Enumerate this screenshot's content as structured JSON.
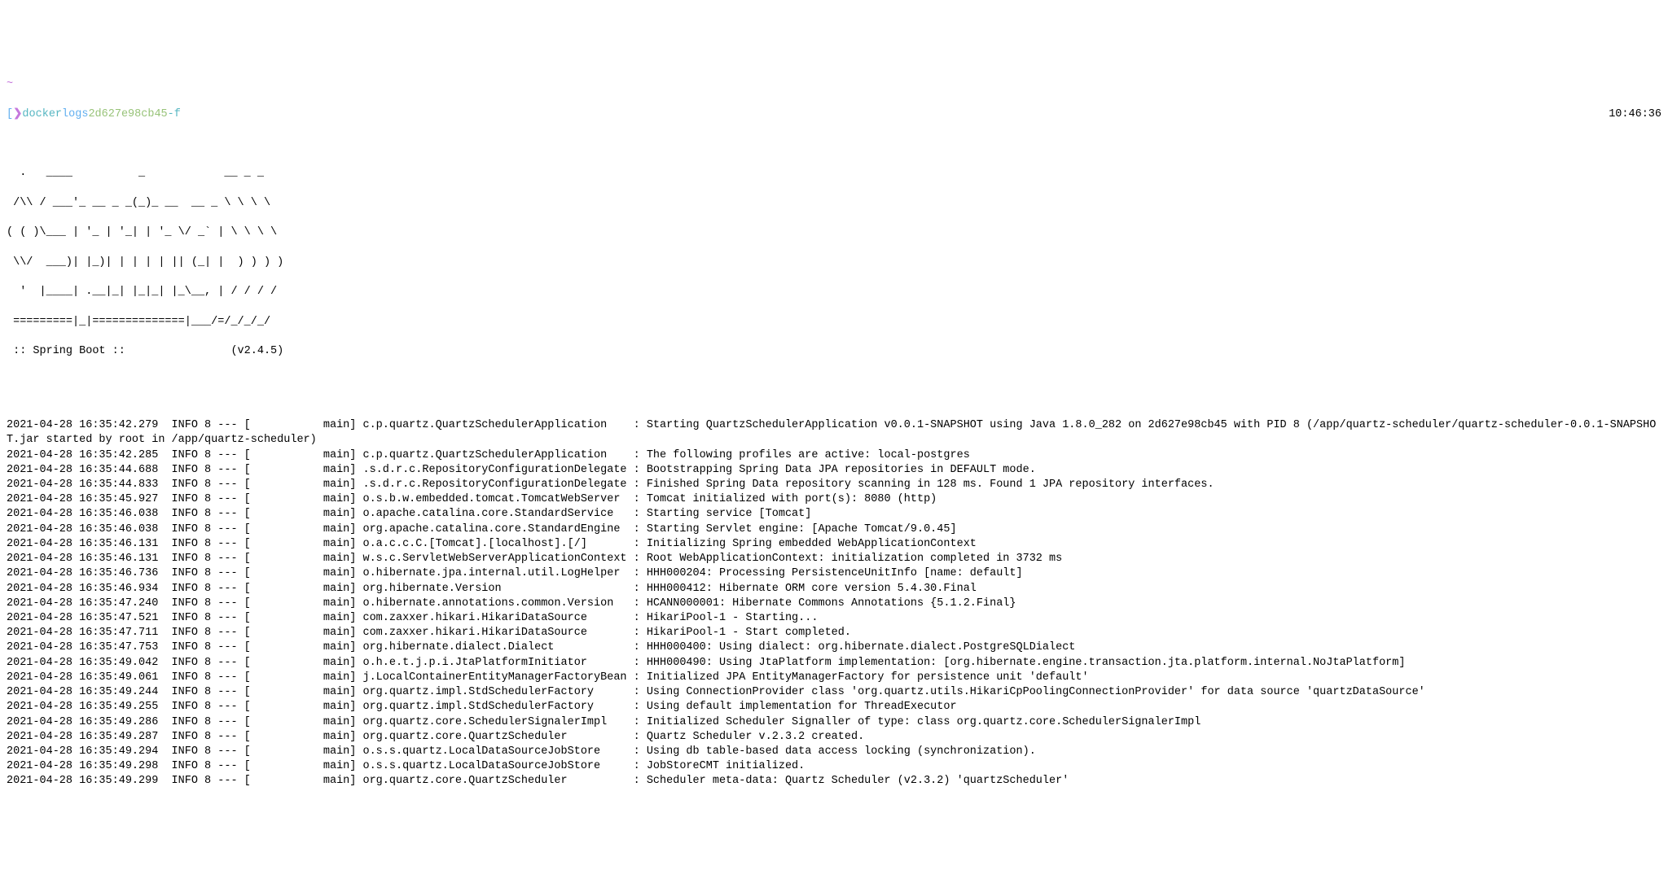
{
  "prompt": {
    "tilde": "~",
    "bracket_open": "[",
    "arrow": "❯",
    "docker": "docker",
    "subcmd": "logs",
    "container_id": "2d627e98cb45",
    "flag": "-f"
  },
  "clock": "10:46:36",
  "banner": {
    "l1": "  .   ____          _            __ _ _",
    "l2": " /\\\\ / ___'_ __ _ _(_)_ __  __ _ \\ \\ \\ \\",
    "l3": "( ( )\\___ | '_ | '_| | '_ \\/ _` | \\ \\ \\ \\",
    "l4": " \\\\/  ___)| |_)| | | | | || (_| |  ) ) ) )",
    "l5": "  '  |____| .__|_| |_|_| |_\\__, | / / / /",
    "l6": " =========|_|==============|___/=/_/_/_/",
    "l7": " :: Spring Boot ::                (v2.4.5)"
  },
  "logs": [
    "2021-04-28 16:35:42.279  INFO 8 --- [           main] c.p.quartz.QuartzSchedulerApplication    : Starting QuartzSchedulerApplication v0.0.1-SNAPSHOT using Java 1.8.0_282 on 2d627e98cb45 with PID 8 (/app/quartz-scheduler/quartz-scheduler-0.0.1-SNAPSHOT.jar started by root in /app/quartz-scheduler)",
    "2021-04-28 16:35:42.285  INFO 8 --- [           main] c.p.quartz.QuartzSchedulerApplication    : The following profiles are active: local-postgres",
    "2021-04-28 16:35:44.688  INFO 8 --- [           main] .s.d.r.c.RepositoryConfigurationDelegate : Bootstrapping Spring Data JPA repositories in DEFAULT mode.",
    "2021-04-28 16:35:44.833  INFO 8 --- [           main] .s.d.r.c.RepositoryConfigurationDelegate : Finished Spring Data repository scanning in 128 ms. Found 1 JPA repository interfaces.",
    "2021-04-28 16:35:45.927  INFO 8 --- [           main] o.s.b.w.embedded.tomcat.TomcatWebServer  : Tomcat initialized with port(s): 8080 (http)",
    "2021-04-28 16:35:46.038  INFO 8 --- [           main] o.apache.catalina.core.StandardService   : Starting service [Tomcat]",
    "2021-04-28 16:35:46.038  INFO 8 --- [           main] org.apache.catalina.core.StandardEngine  : Starting Servlet engine: [Apache Tomcat/9.0.45]",
    "2021-04-28 16:35:46.131  INFO 8 --- [           main] o.a.c.c.C.[Tomcat].[localhost].[/]       : Initializing Spring embedded WebApplicationContext",
    "2021-04-28 16:35:46.131  INFO 8 --- [           main] w.s.c.ServletWebServerApplicationContext : Root WebApplicationContext: initialization completed in 3732 ms",
    "2021-04-28 16:35:46.736  INFO 8 --- [           main] o.hibernate.jpa.internal.util.LogHelper  : HHH000204: Processing PersistenceUnitInfo [name: default]",
    "2021-04-28 16:35:46.934  INFO 8 --- [           main] org.hibernate.Version                    : HHH000412: Hibernate ORM core version 5.4.30.Final",
    "2021-04-28 16:35:47.240  INFO 8 --- [           main] o.hibernate.annotations.common.Version   : HCANN000001: Hibernate Commons Annotations {5.1.2.Final}",
    "2021-04-28 16:35:47.521  INFO 8 --- [           main] com.zaxxer.hikari.HikariDataSource       : HikariPool-1 - Starting...",
    "2021-04-28 16:35:47.711  INFO 8 --- [           main] com.zaxxer.hikari.HikariDataSource       : HikariPool-1 - Start completed.",
    "2021-04-28 16:35:47.753  INFO 8 --- [           main] org.hibernate.dialect.Dialect            : HHH000400: Using dialect: org.hibernate.dialect.PostgreSQLDialect",
    "2021-04-28 16:35:49.042  INFO 8 --- [           main] o.h.e.t.j.p.i.JtaPlatformInitiator       : HHH000490: Using JtaPlatform implementation: [org.hibernate.engine.transaction.jta.platform.internal.NoJtaPlatform]",
    "2021-04-28 16:35:49.061  INFO 8 --- [           main] j.LocalContainerEntityManagerFactoryBean : Initialized JPA EntityManagerFactory for persistence unit 'default'",
    "2021-04-28 16:35:49.244  INFO 8 --- [           main] org.quartz.impl.StdSchedulerFactory      : Using ConnectionProvider class 'org.quartz.utils.HikariCpPoolingConnectionProvider' for data source 'quartzDataSource'",
    "2021-04-28 16:35:49.255  INFO 8 --- [           main] org.quartz.impl.StdSchedulerFactory      : Using default implementation for ThreadExecutor",
    "2021-04-28 16:35:49.286  INFO 8 --- [           main] org.quartz.core.SchedulerSignalerImpl    : Initialized Scheduler Signaller of type: class org.quartz.core.SchedulerSignalerImpl",
    "2021-04-28 16:35:49.287  INFO 8 --- [           main] org.quartz.core.QuartzScheduler          : Quartz Scheduler v.2.3.2 created.",
    "2021-04-28 16:35:49.294  INFO 8 --- [           main] o.s.s.quartz.LocalDataSourceJobStore     : Using db table-based data access locking (synchronization).",
    "2021-04-28 16:35:49.298  INFO 8 --- [           main] o.s.s.quartz.LocalDataSourceJobStore     : JobStoreCMT initialized.",
    "2021-04-28 16:35:49.299  INFO 8 --- [           main] org.quartz.core.QuartzScheduler          : Scheduler meta-data: Quartz Scheduler (v2.3.2) 'quartzScheduler'"
  ]
}
